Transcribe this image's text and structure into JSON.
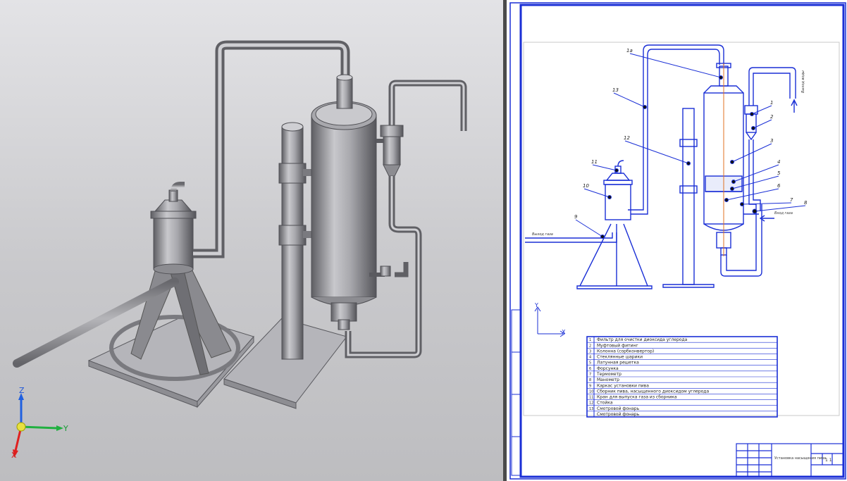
{
  "axes3d": {
    "z": "Z",
    "y": "Y",
    "x": "X"
  },
  "axes2d": {
    "y": "Y",
    "x": "X"
  },
  "colors": {
    "drawing_line": "#1a2fd6",
    "axis_line": "#d0d000",
    "pipe_orange": "#e07020",
    "metal_dark": "#6f6f74",
    "metal_light": "#bdbdc2"
  },
  "callouts": [
    "1a",
    "1",
    "2",
    "3",
    "4",
    "5",
    "6",
    "7",
    "8",
    "9",
    "10",
    "11",
    "12",
    "13"
  ],
  "flow_labels": {
    "left_exit": "Выход газа",
    "right_inlet": "Вход газа",
    "top_right": "Выход воды"
  },
  "spec_table": {
    "rows": [
      {
        "num": "1",
        "name": "Фильтр для очистки диоксида углерода"
      },
      {
        "num": "2",
        "name": "Муфтовый фитинг"
      },
      {
        "num": "3",
        "name": "Колонна (сорбконвертор)"
      },
      {
        "num": "4",
        "name": "Стеклянные шарики"
      },
      {
        "num": "5",
        "name": "Латунная решетка"
      },
      {
        "num": "6",
        "name": "Форсунка"
      },
      {
        "num": "7",
        "name": "Термометр"
      },
      {
        "num": "8",
        "name": "Манометр"
      },
      {
        "num": "9",
        "name": "Каркас установки пива"
      },
      {
        "num": "10",
        "name": "Сборник пива, насыщенного диоксидом углерода"
      },
      {
        "num": "11",
        "name": "Кран для выпуска газа из сборника"
      },
      {
        "num": "12",
        "name": "Стойка"
      },
      {
        "num": "13",
        "name": "Смотровой фонарь"
      }
    ],
    "extra_row": {
      "num": "",
      "name": "Смотровой фонарь"
    }
  },
  "title_block": {
    "title": "Установка насыщения пива",
    "sheet": "1 1"
  }
}
